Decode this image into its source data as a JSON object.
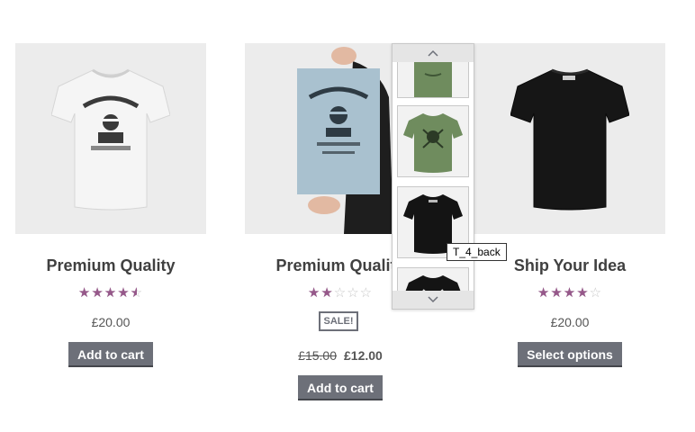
{
  "products": [
    {
      "title": "Premium Quality",
      "rating": 4.5,
      "price": "£20.00",
      "button_label": "Add to cart",
      "image": "white-tshirt-woothemes"
    },
    {
      "title": "Premium Quality",
      "rating": 2,
      "sale_badge": "SALE!",
      "old_price": "£15.00",
      "price": "£12.00",
      "button_label": "Add to cart",
      "image": "woothemes-poster"
    },
    {
      "title": "Ship Your Idea",
      "rating": 4,
      "price": "£20.00",
      "button_label": "Select options",
      "image": "black-tshirt-woo"
    }
  ],
  "gallery": {
    "up_icon": "chevron-up-icon",
    "down_icon": "chevron-down-icon",
    "thumbnails": [
      "green-tshirt-top",
      "green-tshirt-skull",
      "black-tshirt-back",
      "black-tshirt-skull"
    ],
    "tooltip": "T_4_back"
  },
  "colors": {
    "star": "#96588a",
    "button": "#6d7079",
    "image_bg": "#ececec"
  }
}
